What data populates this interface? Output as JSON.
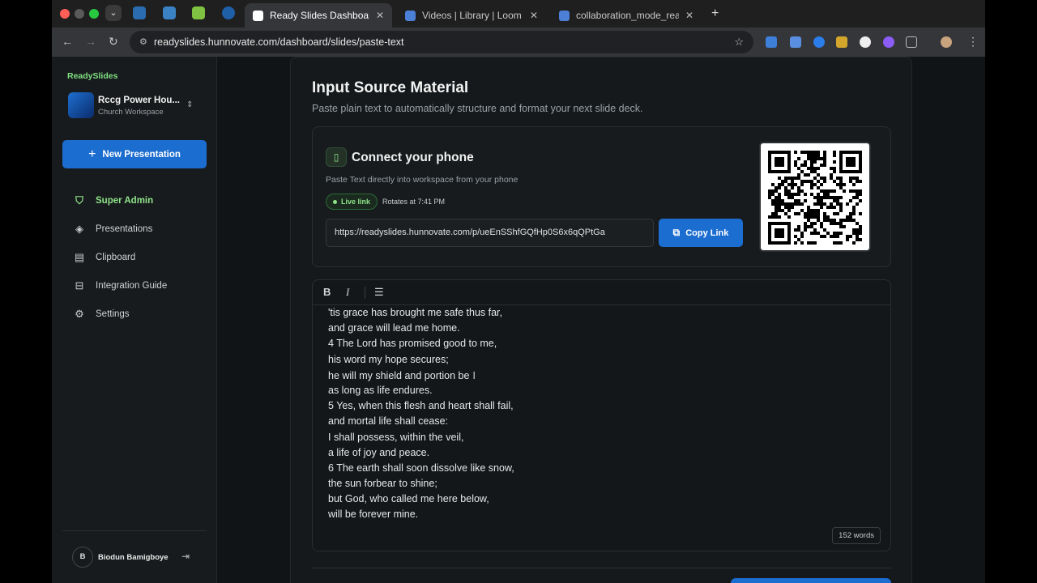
{
  "browser": {
    "tabs": [
      {
        "title": "Ready Slides Dashboard",
        "active": true
      },
      {
        "title": "Videos | Library | Loom",
        "active": false
      },
      {
        "title": "collaboration_mode_ready_s",
        "active": false
      }
    ],
    "url": "readyslides.hunnovate.com/dashboard/slides/paste-text"
  },
  "sidebar": {
    "brand": "ReadySlides",
    "workspace_name": "Rccg Power Hou...",
    "workspace_type": "Church Workspace",
    "new_presentation_label": "New Presentation",
    "nav": [
      {
        "label": "Super Admin",
        "icon": "shield-check-icon",
        "active": true
      },
      {
        "label": "Presentations",
        "icon": "layers-icon",
        "active": false
      },
      {
        "label": "Clipboard",
        "icon": "clipboard-icon",
        "active": false
      },
      {
        "label": "Integration Guide",
        "icon": "book-icon",
        "active": false
      },
      {
        "label": "Settings",
        "icon": "gear-icon",
        "active": false
      }
    ],
    "user_initial": "B",
    "user_name": "Biodun Bamigboye"
  },
  "main": {
    "title": "Input Source Material",
    "subtitle": "Paste plain text to automatically structure and format your next slide deck.",
    "phone": {
      "title": "Connect your phone",
      "description": "Paste Text directly into workspace from your phone",
      "live_label": "Live link",
      "rotates": "Rotates at 7:41 PM",
      "link": "https://readyslides.hunnovate.com/p/ueEnSShfGQfHp0S6x6qQPtGa",
      "copy_label": "Copy Link"
    },
    "editor": {
      "lines": [
        "'tis grace has brought me safe thus far,",
        "and grace will lead me home.",
        "4 The Lord has promised good to me,",
        "his word my hope secures;",
        "he will my shield and portion be",
        "as long as life endures.",
        "5 Yes, when this flesh and heart shall fail,",
        "and mortal life shall cease:",
        "I shall possess, within the veil,",
        "a life of joy and peace.",
        "6 The earth shall soon dissolve like snow,",
        "the sun forbear to shine;",
        "but God, who called me here below,",
        "will be forever mine."
      ],
      "word_count": "152 words"
    }
  },
  "colors": {
    "accent_blue": "#1c6dd0",
    "accent_green": "#8fe38a",
    "background": "#111416"
  }
}
